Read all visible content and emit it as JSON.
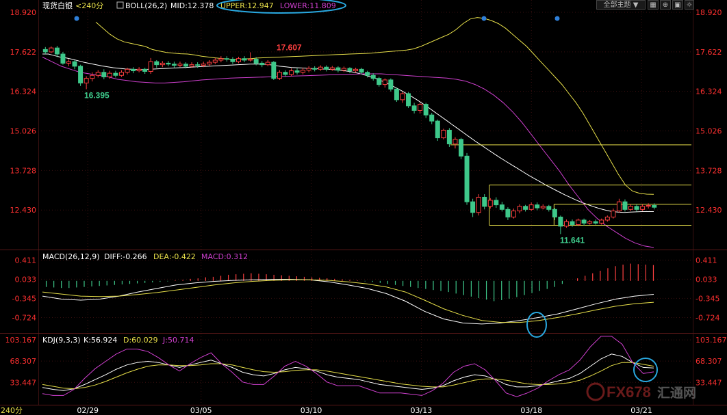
{
  "header": {
    "instrument": "现货白银",
    "period": "<240分",
    "indicator_name": "BOLL(26,2)",
    "mid_label": "MID:12.378",
    "upper_label": "UPPER:12.947",
    "lower_label": "LOWER:11.809",
    "theme_select": "全部主题",
    "theme_arrow": "▼"
  },
  "toolbar": {
    "grid_icon": "grid-icon",
    "zoom_icon": "zoom-icon",
    "settings_icon": "settings-icon"
  },
  "macd_header": {
    "name": "MACD(26,12,9)",
    "diff": "DIFF:-0.266",
    "dea": "DEA:-0.422",
    "macd": "MACD:0.312"
  },
  "kdj_header": {
    "name": "KDJ(9,3,3)",
    "k": "K:56.924",
    "d": "D:60.029",
    "j": "J:50.714"
  },
  "footer": {
    "period_label": "240分"
  },
  "watermark": {
    "text": "FX678",
    "suffix": "汇通网"
  },
  "colors": {
    "up": "#ff4040",
    "down": "#3ec88a",
    "mid": "#ffffff",
    "upper": "#e8e04a",
    "lower": "#d040d0",
    "axis_text": "#ff3030",
    "highlight": "#29a8e0"
  },
  "chart_data": [
    {
      "type": "candlestick",
      "indicator": "BOLL(26,2)",
      "y_ticks": [
        "18.920",
        "17.622",
        "16.324",
        "15.026",
        "13.728",
        "12.430"
      ],
      "ylim": [
        11.2,
        18.92
      ],
      "x_ticks": [
        "02/29",
        "03/05",
        "03/10",
        "03/13",
        "03/18",
        "03/21"
      ],
      "annotations": [
        {
          "label": "17.607",
          "value": 17.607
        },
        {
          "label": "16.395",
          "value": 16.395
        },
        {
          "label": "11.641",
          "value": 11.641
        }
      ],
      "candles": [
        [
          17.7,
          17.62,
          17.78,
          17.55
        ],
        [
          17.62,
          17.75,
          17.8,
          17.58
        ],
        [
          17.75,
          17.55,
          17.82,
          17.45
        ],
        [
          17.55,
          17.25,
          17.62,
          17.2
        ],
        [
          17.25,
          17.3,
          17.38,
          17.15
        ],
        [
          17.3,
          17.15,
          17.35,
          17.05
        ],
        [
          17.15,
          16.6,
          17.2,
          16.5
        ],
        [
          16.6,
          16.75,
          16.82,
          16.395
        ],
        [
          16.75,
          16.85,
          16.95,
          16.65
        ],
        [
          16.85,
          16.95,
          17.02,
          16.78
        ],
        [
          16.95,
          16.8,
          17.05,
          16.72
        ],
        [
          16.8,
          16.92,
          17.0,
          16.74
        ],
        [
          16.92,
          16.85,
          17.0,
          16.78
        ],
        [
          16.85,
          16.95,
          17.02,
          16.8
        ],
        [
          16.95,
          17.05,
          17.1,
          16.88
        ],
        [
          17.05,
          17.0,
          17.12,
          16.92
        ],
        [
          17.0,
          17.05,
          17.12,
          16.95
        ],
        [
          17.05,
          16.98,
          17.1,
          16.9
        ],
        [
          16.98,
          17.3,
          17.42,
          16.9
        ],
        [
          17.3,
          17.2,
          17.35,
          17.1
        ],
        [
          17.2,
          17.25,
          17.32,
          17.12
        ],
        [
          17.25,
          17.22,
          17.32,
          17.15
        ],
        [
          17.22,
          17.18,
          17.3,
          17.1
        ],
        [
          17.18,
          17.22,
          17.3,
          17.12
        ],
        [
          17.22,
          17.15,
          17.28,
          17.08
        ],
        [
          17.15,
          17.2,
          17.28,
          17.1
        ],
        [
          17.2,
          17.18,
          17.28,
          17.1
        ],
        [
          17.18,
          17.22,
          17.3,
          17.12
        ],
        [
          17.22,
          17.28,
          17.35,
          17.15
        ],
        [
          17.28,
          17.35,
          17.42,
          17.22
        ],
        [
          17.35,
          17.4,
          17.48,
          17.28
        ],
        [
          17.4,
          17.38,
          17.48,
          17.3
        ],
        [
          17.38,
          17.3,
          17.45,
          17.22
        ],
        [
          17.3,
          17.4,
          17.46,
          17.25
        ],
        [
          17.4,
          17.35,
          17.48,
          17.28
        ],
        [
          17.35,
          17.38,
          17.607,
          17.3
        ],
        [
          17.38,
          17.25,
          17.45,
          17.18
        ],
        [
          17.25,
          17.2,
          17.32,
          17.12
        ],
        [
          17.2,
          17.28,
          17.35,
          17.15
        ],
        [
          17.28,
          16.75,
          17.32,
          16.7
        ],
        [
          16.75,
          16.95,
          17.02,
          16.7
        ],
        [
          16.95,
          16.88,
          17.02,
          16.8
        ],
        [
          16.88,
          17.0,
          17.08,
          16.82
        ],
        [
          17.0,
          16.95,
          17.08,
          16.88
        ],
        [
          16.95,
          17.02,
          17.1,
          16.88
        ],
        [
          17.02,
          17.08,
          17.15,
          16.95
        ],
        [
          17.08,
          17.05,
          17.15,
          16.98
        ],
        [
          17.05,
          17.12,
          17.18,
          17.0
        ],
        [
          17.12,
          17.05,
          17.18,
          16.98
        ],
        [
          17.05,
          17.1,
          17.16,
          17.0
        ],
        [
          17.1,
          17.02,
          17.15,
          16.95
        ],
        [
          17.02,
          17.08,
          17.14,
          16.96
        ],
        [
          17.08,
          17.0,
          17.12,
          16.92
        ],
        [
          17.0,
          17.05,
          17.1,
          16.94
        ],
        [
          17.05,
          16.95,
          17.1,
          16.88
        ],
        [
          16.95,
          16.85,
          17.0,
          16.78
        ],
        [
          16.85,
          16.75,
          16.92,
          16.68
        ],
        [
          16.75,
          16.55,
          16.8,
          16.48
        ],
        [
          16.55,
          16.7,
          16.75,
          16.45
        ],
        [
          16.7,
          16.4,
          16.75,
          16.32
        ],
        [
          16.4,
          16.05,
          16.45,
          15.98
        ],
        [
          16.05,
          16.25,
          16.32,
          15.95
        ],
        [
          16.25,
          15.85,
          16.3,
          15.78
        ],
        [
          15.85,
          15.7,
          15.95,
          15.6
        ],
        [
          15.7,
          15.9,
          15.95,
          15.6
        ],
        [
          15.9,
          15.55,
          15.95,
          15.45
        ],
        [
          15.55,
          15.35,
          15.62,
          15.25
        ],
        [
          15.35,
          14.8,
          15.4,
          14.7
        ],
        [
          14.8,
          15.05,
          15.1,
          14.75
        ],
        [
          15.05,
          14.6,
          15.12,
          14.5
        ],
        [
          14.6,
          14.75,
          14.82,
          14.45
        ],
        [
          14.75,
          14.2,
          14.8,
          14.1
        ],
        [
          14.2,
          12.7,
          14.3,
          12.6
        ],
        [
          12.7,
          12.35,
          12.8,
          12.2
        ],
        [
          12.35,
          12.85,
          12.95,
          12.25
        ],
        [
          12.85,
          12.55,
          12.95,
          12.45
        ],
        [
          12.55,
          12.75,
          12.82,
          12.48
        ],
        [
          12.75,
          12.6,
          12.85,
          12.5
        ],
        [
          12.6,
          12.45,
          12.7,
          12.38
        ],
        [
          12.45,
          12.2,
          12.52,
          12.1
        ],
        [
          12.2,
          12.4,
          12.48,
          12.15
        ],
        [
          12.4,
          12.55,
          12.62,
          12.32
        ],
        [
          12.55,
          12.45,
          12.6,
          12.38
        ],
        [
          12.45,
          12.6,
          12.68,
          12.4
        ],
        [
          12.6,
          12.5,
          12.68,
          12.42
        ],
        [
          12.5,
          12.55,
          12.62,
          12.45
        ],
        [
          12.55,
          12.45,
          12.6,
          12.38
        ],
        [
          12.45,
          12.2,
          12.5,
          12.1
        ],
        [
          12.2,
          11.9,
          12.25,
          11.641
        ],
        [
          11.9,
          12.05,
          12.12,
          11.85
        ],
        [
          12.05,
          11.95,
          12.12,
          11.88
        ],
        [
          11.95,
          12.1,
          12.15,
          11.9
        ],
        [
          12.1,
          12.0,
          12.15,
          11.92
        ],
        [
          12.0,
          12.05,
          12.1,
          11.95
        ],
        [
          12.05,
          12.0,
          12.12,
          11.95
        ],
        [
          12.0,
          12.1,
          12.15,
          11.95
        ],
        [
          12.1,
          12.2,
          12.25,
          12.05
        ],
        [
          12.2,
          12.4,
          12.48,
          12.15
        ],
        [
          12.4,
          12.7,
          12.8,
          12.35
        ],
        [
          12.7,
          12.45,
          12.78,
          12.38
        ],
        [
          12.45,
          12.55,
          12.62,
          12.4
        ],
        [
          12.55,
          12.45,
          12.62,
          12.38
        ],
        [
          12.45,
          12.55,
          12.62,
          12.4
        ],
        [
          12.55,
          12.58,
          12.65,
          12.48
        ],
        [
          12.58,
          12.52,
          12.65,
          12.45
        ]
      ],
      "mid": [
        17.55,
        17.55,
        17.5,
        17.45,
        17.42,
        17.38,
        17.33,
        17.28,
        17.24,
        17.2,
        17.16,
        17.13,
        17.1,
        17.08,
        17.06,
        17.05,
        17.04,
        17.04,
        17.05,
        17.06,
        17.07,
        17.08,
        17.09,
        17.1,
        17.11,
        17.12,
        17.13,
        17.14,
        17.15,
        17.16,
        17.17,
        17.18,
        17.19,
        17.2,
        17.21,
        17.22,
        17.22,
        17.22,
        17.21,
        17.18,
        17.15,
        17.13,
        17.11,
        17.1,
        17.09,
        17.08,
        17.07,
        17.06,
        17.05,
        17.04,
        17.02,
        17.0,
        16.97,
        16.93,
        16.88,
        16.82,
        16.76,
        16.68,
        16.6,
        16.5,
        16.4,
        16.29,
        16.18,
        16.06,
        15.93,
        15.8,
        15.66,
        15.52,
        15.38,
        15.24,
        15.1,
        14.96,
        14.82,
        14.68,
        14.55,
        14.42,
        14.29,
        14.16,
        14.04,
        13.92,
        13.8,
        13.68,
        13.56,
        13.45,
        13.34,
        13.23,
        13.13,
        13.03,
        12.93,
        12.84,
        12.75,
        12.67,
        12.6,
        12.53,
        12.47,
        12.42,
        12.38,
        12.36,
        12.35,
        12.36,
        12.37,
        12.378,
        12.378,
        12.378
      ],
      "upper": [
        18.6,
        18.4,
        18.2,
        18.05,
        17.95,
        17.9,
        17.85,
        17.8,
        17.7,
        17.65,
        17.6,
        17.58,
        17.56,
        17.55,
        17.52,
        17.48,
        17.45,
        17.42,
        17.4,
        17.38,
        17.38,
        17.39,
        17.4,
        17.42,
        17.43,
        17.44,
        17.45,
        17.46,
        17.47,
        17.48,
        17.49,
        17.5,
        17.51,
        17.52,
        17.53,
        17.54,
        17.55,
        17.56,
        17.57,
        17.58,
        17.6,
        17.62,
        17.64,
        17.66,
        17.68,
        17.72,
        17.8,
        17.9,
        18.0,
        18.1,
        18.2,
        18.35,
        18.55,
        18.7,
        18.75,
        18.72,
        18.65,
        18.55,
        18.4,
        18.2,
        18.0,
        17.8,
        17.55,
        17.3,
        17.05,
        16.8,
        16.55,
        16.25,
        15.95,
        15.6,
        15.2,
        14.8,
        14.4,
        14.0,
        13.6,
        13.25,
        13.05,
        12.98,
        12.95,
        12.947
      ],
      "lower": [
        17.45,
        17.3,
        17.15,
        17.05,
        16.95,
        16.9,
        16.85,
        16.8,
        16.72,
        16.68,
        16.64,
        16.62,
        16.6,
        16.6,
        16.62,
        16.64,
        16.67,
        16.7,
        16.72,
        16.74,
        16.76,
        16.77,
        16.78,
        16.79,
        16.8,
        16.81,
        16.82,
        16.83,
        16.84,
        16.85,
        16.86,
        16.87,
        16.88,
        16.89,
        16.9,
        16.9,
        16.9,
        16.88,
        16.86,
        16.84,
        16.82,
        16.8,
        16.78,
        16.76,
        16.72,
        16.66,
        16.55,
        16.4,
        16.2,
        15.95,
        15.65,
        15.3,
        14.9,
        14.5,
        14.1,
        13.7,
        13.25,
        12.85,
        12.45,
        12.15,
        11.9,
        11.7,
        11.5,
        11.35,
        11.25,
        11.2
      ],
      "horizontal_lines": [
        {
          "value": 14.57,
          "from": 0.63
        },
        {
          "value": 13.25,
          "from": 0.69
        },
        {
          "value": 12.62,
          "from": 0.79
        },
        {
          "value": 11.93,
          "from": 0.69
        }
      ],
      "boxes": [
        {
          "x0": 0.69,
          "x1": 0.79,
          "y_top": 13.25,
          "y_bottom": 11.93
        },
        {
          "x0": 0.79,
          "x1": 0.89,
          "y_top": 12.62,
          "y_bottom": 11.93
        }
      ]
    },
    {
      "type": "histogram_line",
      "indicator": "MACD(26,12,9)",
      "y_ticks": [
        "0.411",
        "0.033",
        "-0.345",
        "-0.724"
      ],
      "ylim": [
        -1.0,
        0.55
      ],
      "histogram": [
        -0.12,
        -0.13,
        -0.14,
        -0.14,
        -0.13,
        -0.12,
        -0.11,
        -0.1,
        -0.09,
        -0.08,
        -0.07,
        -0.06,
        -0.05,
        -0.04,
        -0.03,
        -0.02,
        -0.01,
        0.01,
        0.02,
        0.04,
        0.05,
        0.07,
        0.08,
        0.1,
        0.12,
        0.13,
        0.14,
        0.15,
        0.14,
        0.13,
        0.12,
        0.11,
        0.1,
        0.09,
        0.08,
        0.07,
        0.06,
        0.05,
        0.04,
        0.03,
        0.02,
        0.01,
        -0.01,
        -0.02,
        -0.04,
        -0.06,
        -0.08,
        -0.1,
        -0.12,
        -0.14,
        -0.16,
        -0.18,
        -0.2,
        -0.22,
        -0.25,
        -0.28,
        -0.31,
        -0.34,
        -0.37,
        -0.4,
        -0.38,
        -0.35,
        -0.32,
        -0.28,
        -0.24,
        -0.2,
        -0.16,
        -0.12,
        -0.06,
        0.0,
        0.05,
        0.1,
        0.15,
        0.2,
        0.25,
        0.29,
        0.32,
        0.34,
        0.33,
        0.32,
        0.312
      ],
      "diff": [
        -0.3,
        -0.36,
        -0.38,
        -0.36,
        -0.3,
        -0.22,
        -0.15,
        -0.08,
        -0.04,
        -0.01,
        0.01,
        0.02,
        0.03,
        0.03,
        0.02,
        -0.02,
        -0.08,
        -0.15,
        -0.25,
        -0.4,
        -0.6,
        -0.75,
        -0.83,
        -0.85,
        -0.83,
        -0.78,
        -0.72,
        -0.65,
        -0.55,
        -0.45,
        -0.36,
        -0.3,
        -0.266
      ],
      "dea": [
        -0.22,
        -0.26,
        -0.3,
        -0.31,
        -0.3,
        -0.27,
        -0.23,
        -0.18,
        -0.13,
        -0.08,
        -0.04,
        -0.01,
        0.01,
        0.02,
        0.02,
        0.01,
        -0.02,
        -0.06,
        -0.12,
        -0.22,
        -0.38,
        -0.55,
        -0.68,
        -0.78,
        -0.82,
        -0.82,
        -0.78,
        -0.72,
        -0.65,
        -0.57,
        -0.5,
        -0.45,
        -0.422
      ]
    },
    {
      "type": "line",
      "indicator": "KDJ(9,3,3)",
      "y_ticks": [
        "103.167",
        "68.307",
        "33.447"
      ],
      "ylim": [
        -1.0,
        110.0
      ],
      "k": [
        25,
        22,
        20,
        23,
        30,
        38,
        46,
        55,
        62,
        66,
        68,
        66,
        62,
        58,
        62,
        66,
        70,
        64,
        58,
        50,
        46,
        44,
        48,
        54,
        58,
        56,
        52,
        46,
        42,
        40,
        38,
        34,
        30,
        28,
        26,
        24,
        22,
        24,
        28,
        36,
        42,
        46,
        44,
        38,
        30,
        26,
        26,
        28,
        32,
        36,
        40,
        48,
        60,
        72,
        80,
        76,
        66,
        58,
        56.924
      ],
      "d": [
        30,
        27,
        24,
        23,
        25,
        29,
        35,
        42,
        49,
        55,
        60,
        62,
        62,
        61,
        61,
        62,
        64,
        64,
        62,
        58,
        54,
        51,
        50,
        51,
        53,
        54,
        54,
        52,
        49,
        46,
        43,
        40,
        37,
        34,
        31,
        29,
        27,
        26,
        26,
        29,
        33,
        37,
        39,
        39,
        37,
        34,
        31,
        30,
        30,
        31,
        33,
        37,
        44,
        52,
        61,
        66,
        66,
        63,
        60.029
      ],
      "j": [
        15,
        12,
        12,
        22,
        40,
        56,
        68,
        80,
        88,
        88,
        84,
        74,
        62,
        52,
        64,
        74,
        82,
        64,
        50,
        34,
        30,
        30,
        44,
        60,
        68,
        60,
        48,
        34,
        28,
        28,
        28,
        22,
        16,
        16,
        16,
        14,
        12,
        20,
        32,
        50,
        60,
        64,
        54,
        36,
        16,
        10,
        16,
        24,
        36,
        46,
        54,
        70,
        92,
        112,
        118,
        96,
        66,
        48,
        50.714
      ]
    }
  ]
}
